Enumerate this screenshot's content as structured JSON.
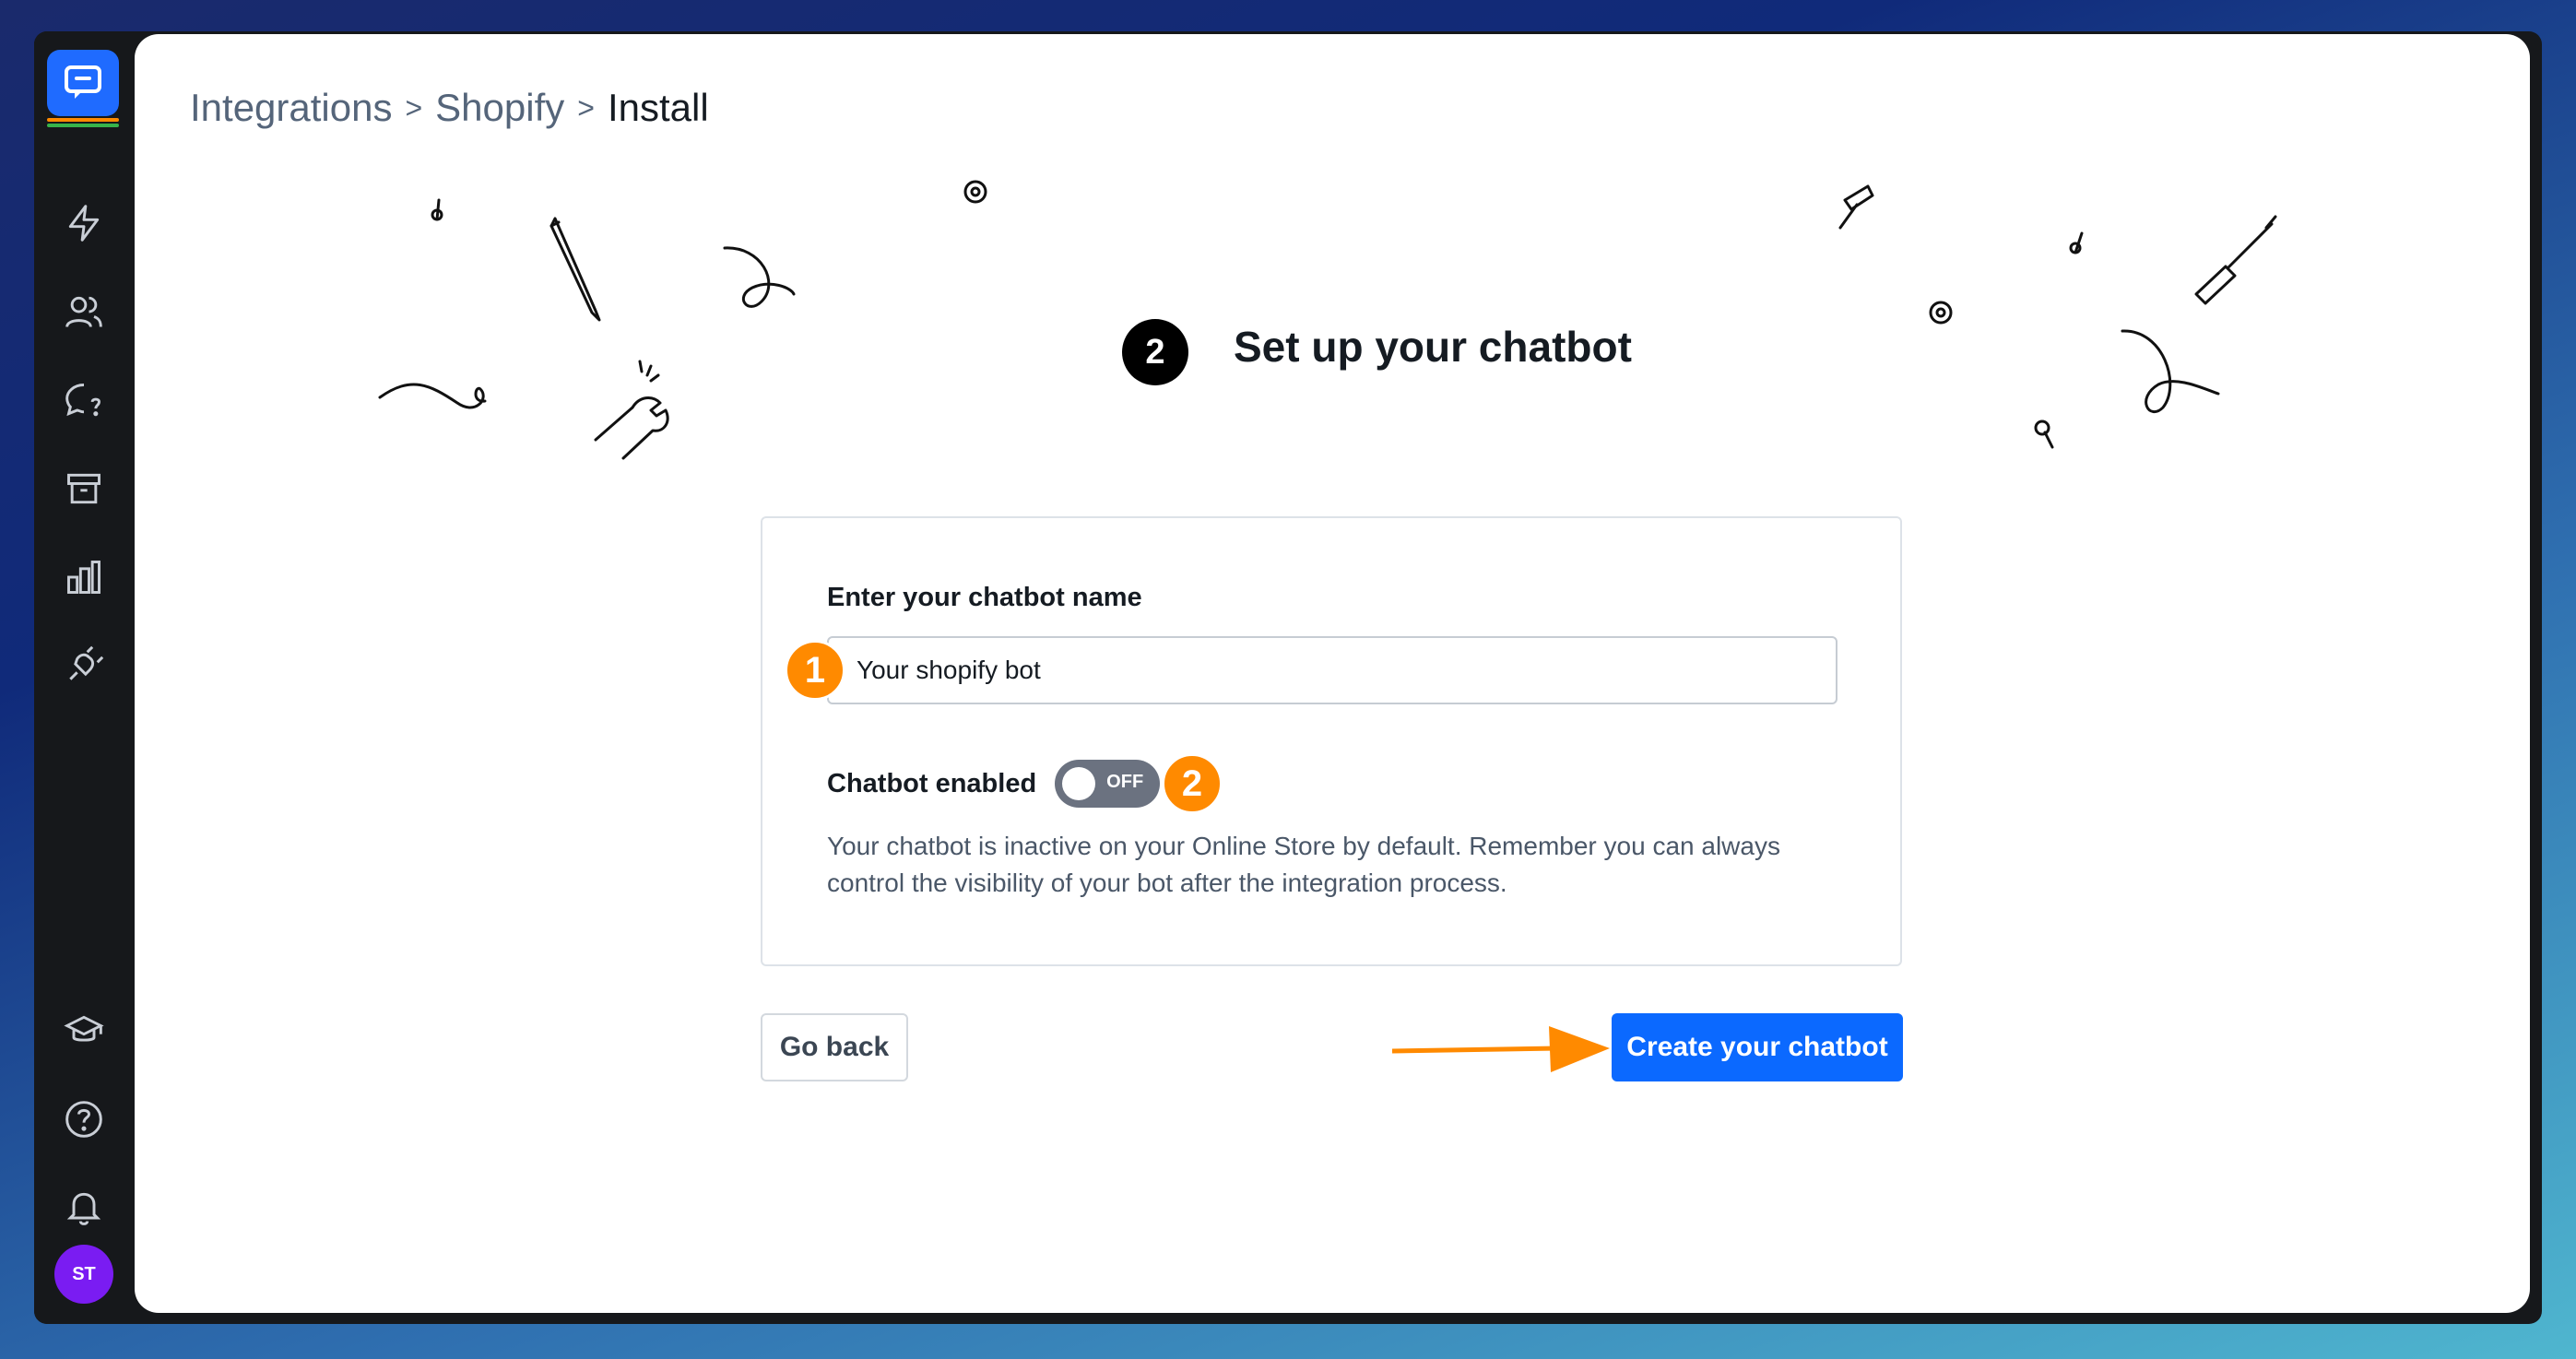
{
  "breadcrumb": {
    "items": [
      "Integrations",
      "Shopify",
      "Install"
    ],
    "separator": ">"
  },
  "step": {
    "number": "2",
    "title": "Set up your chatbot"
  },
  "form": {
    "name_label": "Enter your chatbot name",
    "name_value": "Your shopify bot",
    "enabled_label": "Chatbot enabled",
    "toggle_state": "OFF",
    "help_text": "Your chatbot is inactive on your Online Store by default. Remember you can always control the visibility of your bot after the integration process."
  },
  "markers": [
    "1",
    "2"
  ],
  "actions": {
    "back_label": "Go back",
    "create_label": "Create your chatbot"
  },
  "user": {
    "initials": "ST"
  },
  "sidebar_icons": [
    "bolt-icon",
    "users-icon",
    "chat-question-icon",
    "archive-icon",
    "bar-chart-icon",
    "plug-icon",
    "graduation-cap-icon",
    "help-icon",
    "bell-icon"
  ],
  "colors": {
    "primary": "#0b69ff",
    "marker": "#ff8a00",
    "avatar": "#7a1cf2"
  }
}
